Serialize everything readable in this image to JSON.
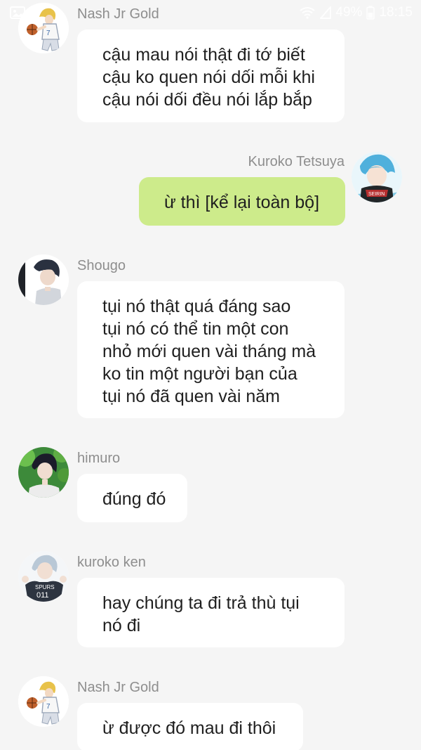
{
  "status_bar": {
    "battery_text": "49%",
    "time_text": "18:15",
    "icons": [
      "image-icon",
      "wifi-icon",
      "signal-icon",
      "battery-icon"
    ]
  },
  "colors": {
    "background": "#f5f5f5",
    "bubble_other": "#ffffff",
    "bubble_mine": "#cdeb8b",
    "sender_text": "#8e8e8e"
  },
  "messages": [
    {
      "sender": "Nash Jr Gold",
      "side": "left",
      "avatar": "blond-basketball-player-avatar",
      "lines": [
        "cậu mau nói thật đi tớ biết",
        "cậu ko quen nói dối mỗi khi",
        "cậu nói dối đều nói lắp bắp"
      ]
    },
    {
      "sender": "Kuroko Tetsuya",
      "side": "right",
      "avatar": "blue-hair-seirin-avatar",
      "lines": [
        "ừ thì [kể lại toàn bộ]"
      ]
    },
    {
      "sender": "Shougo",
      "side": "left",
      "avatar": "dark-hair-boy-avatar",
      "lines": [
        "tụi nó thật quá đáng sao",
        "tụi nó có thể tin một con",
        "nhỏ mới quen vài tháng mà",
        "ko tin một người bạn của",
        "tụi nó đã quen vài năm"
      ]
    },
    {
      "sender": "himuro",
      "side": "left",
      "avatar": "black-hair-forest-avatar",
      "lines": [
        "đúng đó"
      ]
    },
    {
      "sender": "kuroko ken",
      "side": "left",
      "avatar": "silver-hair-spurs-avatar",
      "lines": [
        "hay chúng ta đi trả thù tụi",
        "nó đi"
      ]
    },
    {
      "sender": "Nash Jr Gold",
      "side": "left",
      "avatar": "blond-basketball-player-avatar",
      "lines": [
        "ừ được đó mau đi thôi"
      ]
    }
  ]
}
